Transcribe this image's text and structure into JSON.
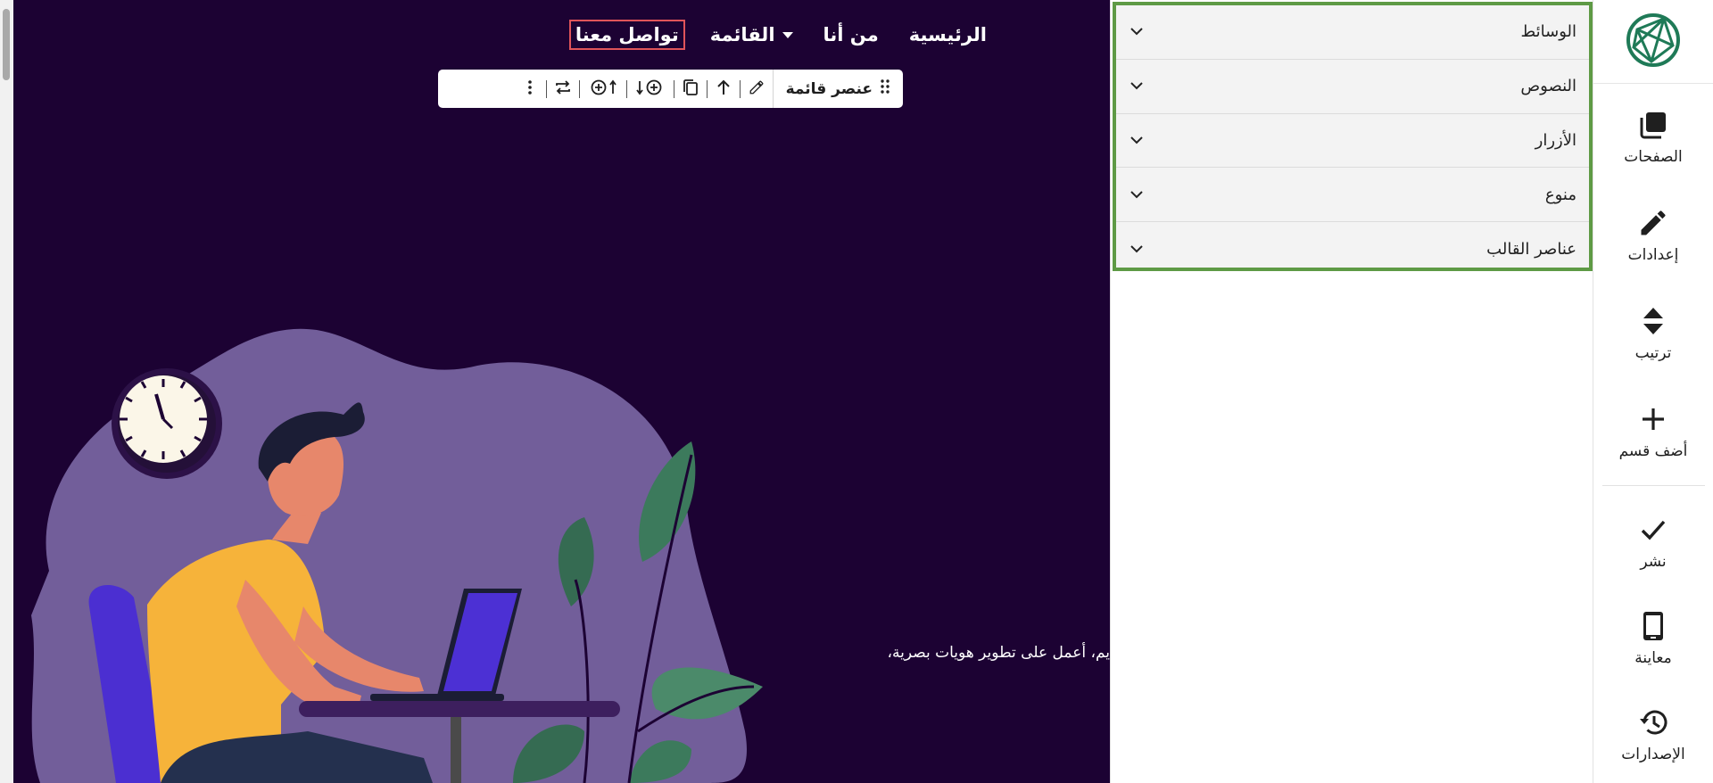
{
  "site_nav": {
    "items": [
      {
        "label": "الرئيسية"
      },
      {
        "label": "من أنا"
      },
      {
        "label": "القائمة"
      },
      {
        "label": "تواصل معنا"
      }
    ]
  },
  "element_toolbar": {
    "label": "عنصر قائمة",
    "icons": [
      "drag-handle-icon",
      "edit-icon",
      "move-up-icon",
      "duplicate-icon",
      "add-below-icon",
      "add-above-icon",
      "swap-icon",
      "more-options-icon"
    ]
  },
  "hero": {
    "intro_text": "يم، أعمل على تطوير هويات بصرية،"
  },
  "elements_panel": {
    "sections": [
      {
        "title": "الوسائط"
      },
      {
        "title": "النصوص"
      },
      {
        "title": "الأزرار"
      },
      {
        "title": "منوع"
      },
      {
        "title": "عناصر القالب"
      }
    ]
  },
  "sidebar": {
    "top_items": [
      {
        "label": "الصفحات",
        "icon": "pages-icon"
      },
      {
        "label": "إعدادات",
        "icon": "pencil-icon"
      },
      {
        "label": "ترتيب",
        "icon": "sort-icon"
      },
      {
        "label": "أضف قسم",
        "icon": "plus-icon"
      }
    ],
    "bottom_items": [
      {
        "label": "نشر",
        "icon": "check-icon"
      },
      {
        "label": "معاينة",
        "icon": "phone-icon"
      },
      {
        "label": "الإصدارات",
        "icon": "history-icon"
      }
    ]
  },
  "colors": {
    "canvas_bg": "#1c0233",
    "accent_green": "#5e9a45",
    "logo_green": "#1f7a57",
    "selection_red": "#e0545a"
  }
}
